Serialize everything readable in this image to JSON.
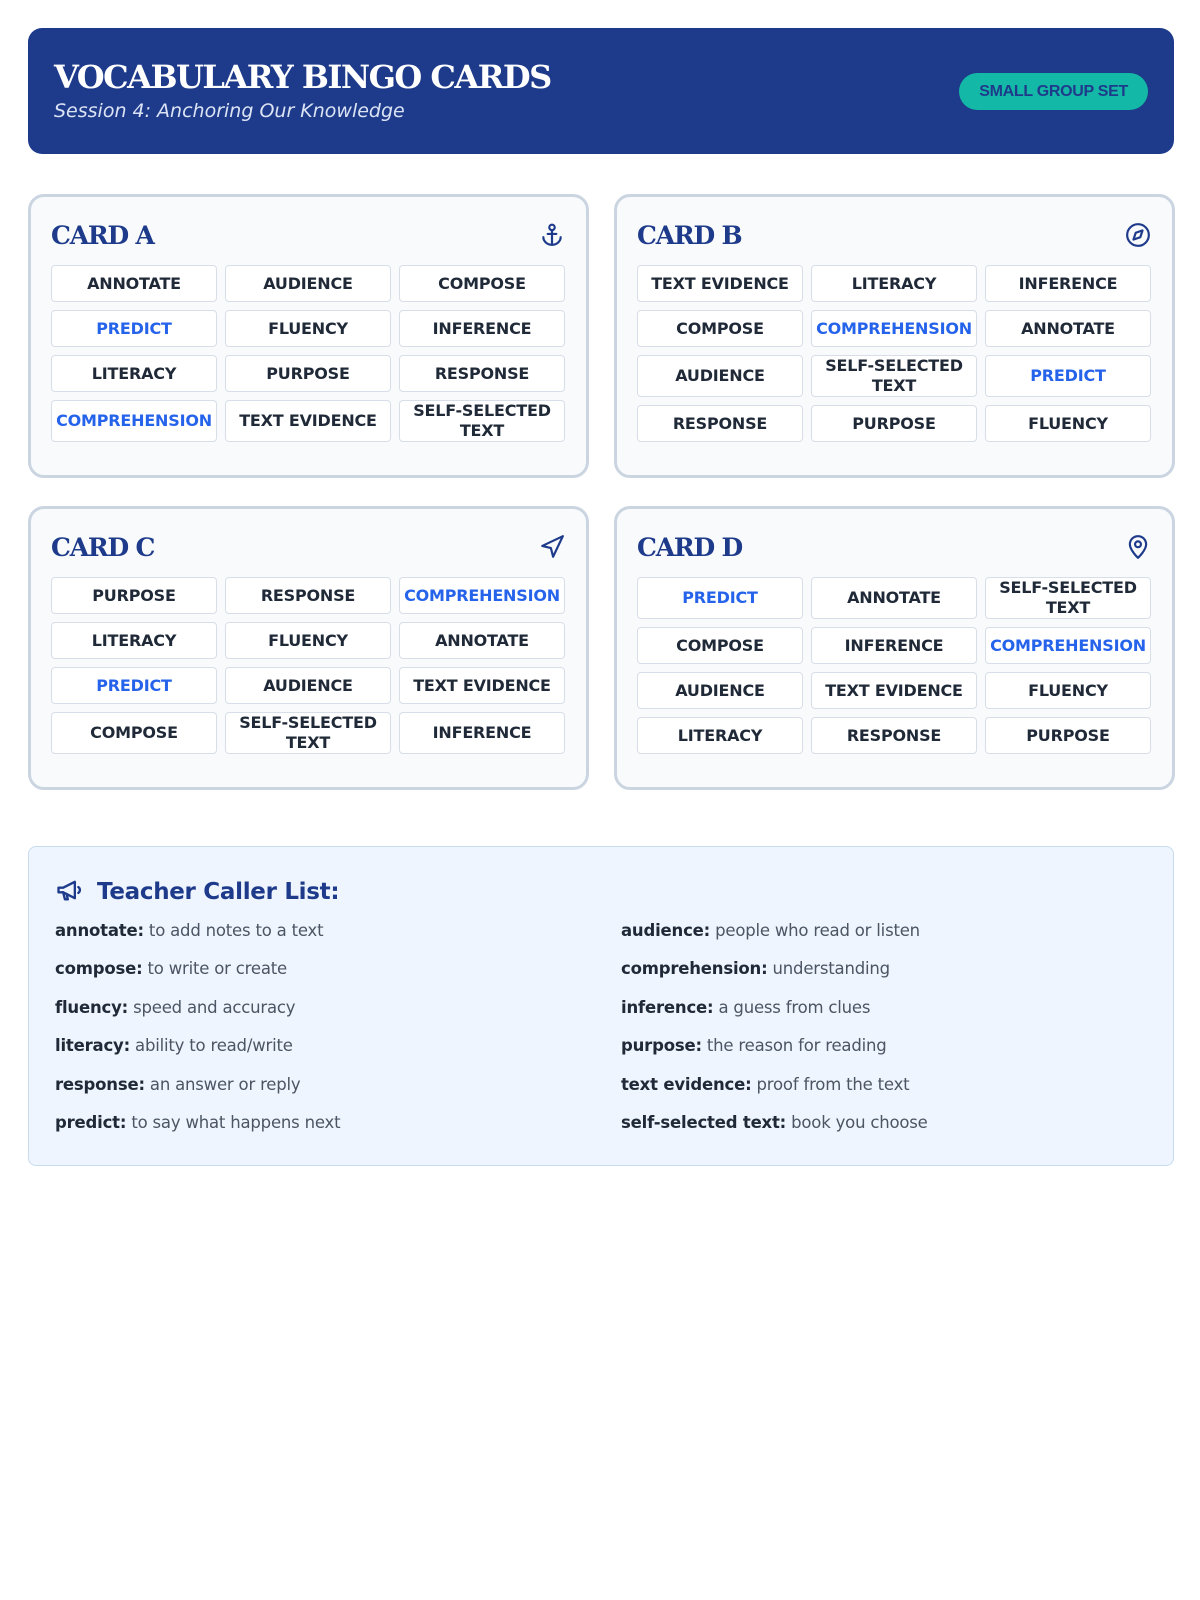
{
  "header": {
    "title": "VOCABULARY BINGO CARDS",
    "subtitle": "Session 4: Anchoring Our Knowledge",
    "badge": "SMALL GROUP SET"
  },
  "colors": {
    "navy": "#1e3a8a",
    "teal": "#14b8a6",
    "highlight_blue": "#2563eb",
    "card_border": "#cbd5e1",
    "caller_bg": "#eef5fe"
  },
  "cards": [
    {
      "title": "CARD A",
      "icon": "anchor-icon",
      "cells": [
        {
          "text": "ANNOTATE",
          "hl": false
        },
        {
          "text": "AUDIENCE",
          "hl": false
        },
        {
          "text": "COMPOSE",
          "hl": false
        },
        {
          "text": "PREDICT",
          "hl": true
        },
        {
          "text": "FLUENCY",
          "hl": false
        },
        {
          "text": "INFERENCE",
          "hl": false
        },
        {
          "text": "LITERACY",
          "hl": false
        },
        {
          "text": "PURPOSE",
          "hl": false
        },
        {
          "text": "RESPONSE",
          "hl": false
        },
        {
          "text": "COMPREHENSION",
          "hl": true
        },
        {
          "text": "TEXT EVIDENCE",
          "hl": false
        },
        {
          "text": "SELF-SELECTED TEXT",
          "hl": false
        }
      ]
    },
    {
      "title": "CARD B",
      "icon": "compass-icon",
      "cells": [
        {
          "text": "TEXT EVIDENCE",
          "hl": false
        },
        {
          "text": "LITERACY",
          "hl": false
        },
        {
          "text": "INFERENCE",
          "hl": false
        },
        {
          "text": "COMPOSE",
          "hl": false
        },
        {
          "text": "COMPREHENSION",
          "hl": true
        },
        {
          "text": "ANNOTATE",
          "hl": false
        },
        {
          "text": "AUDIENCE",
          "hl": false
        },
        {
          "text": "SELF-SELECTED TEXT",
          "hl": false
        },
        {
          "text": "PREDICT",
          "hl": true
        },
        {
          "text": "RESPONSE",
          "hl": false
        },
        {
          "text": "PURPOSE",
          "hl": false
        },
        {
          "text": "FLUENCY",
          "hl": false
        }
      ]
    },
    {
      "title": "CARD C",
      "icon": "navigation-icon",
      "cells": [
        {
          "text": "PURPOSE",
          "hl": false
        },
        {
          "text": "RESPONSE",
          "hl": false
        },
        {
          "text": "COMPREHENSION",
          "hl": true
        },
        {
          "text": "LITERACY",
          "hl": false
        },
        {
          "text": "FLUENCY",
          "hl": false
        },
        {
          "text": "ANNOTATE",
          "hl": false
        },
        {
          "text": "PREDICT",
          "hl": true
        },
        {
          "text": "AUDIENCE",
          "hl": false
        },
        {
          "text": "TEXT EVIDENCE",
          "hl": false
        },
        {
          "text": "COMPOSE",
          "hl": false
        },
        {
          "text": "SELF-SELECTED TEXT",
          "hl": false
        },
        {
          "text": "INFERENCE",
          "hl": false
        }
      ]
    },
    {
      "title": "CARD D",
      "icon": "map-pin-icon",
      "cells": [
        {
          "text": "PREDICT",
          "hl": true
        },
        {
          "text": "ANNOTATE",
          "hl": false
        },
        {
          "text": "SELF-SELECTED TEXT",
          "hl": false
        },
        {
          "text": "COMPOSE",
          "hl": false
        },
        {
          "text": "INFERENCE",
          "hl": false
        },
        {
          "text": "COMPREHENSION",
          "hl": true
        },
        {
          "text": "AUDIENCE",
          "hl": false
        },
        {
          "text": "TEXT EVIDENCE",
          "hl": false
        },
        {
          "text": "FLUENCY",
          "hl": false
        },
        {
          "text": "LITERACY",
          "hl": false
        },
        {
          "text": "RESPONSE",
          "hl": false
        },
        {
          "text": "PURPOSE",
          "hl": false
        }
      ]
    }
  ],
  "caller": {
    "title": "Teacher Caller List:",
    "icon": "megaphone-icon",
    "left": [
      {
        "term": "annotate:",
        "def": "to add notes to a text"
      },
      {
        "term": "compose:",
        "def": "to write or create"
      },
      {
        "term": "fluency:",
        "def": "speed and accuracy"
      },
      {
        "term": "literacy:",
        "def": "ability to read/write"
      },
      {
        "term": "response:",
        "def": "an answer or reply"
      },
      {
        "term": "predict:",
        "def": "to say what happens next"
      }
    ],
    "right": [
      {
        "term": "audience:",
        "def": "people who read or listen"
      },
      {
        "term": "comprehension:",
        "def": "understanding"
      },
      {
        "term": "inference:",
        "def": "a guess from clues"
      },
      {
        "term": "purpose:",
        "def": "the reason for reading"
      },
      {
        "term": "text evidence:",
        "def": "proof from the text"
      },
      {
        "term": "self-selected text:",
        "def": "book you choose"
      }
    ]
  }
}
